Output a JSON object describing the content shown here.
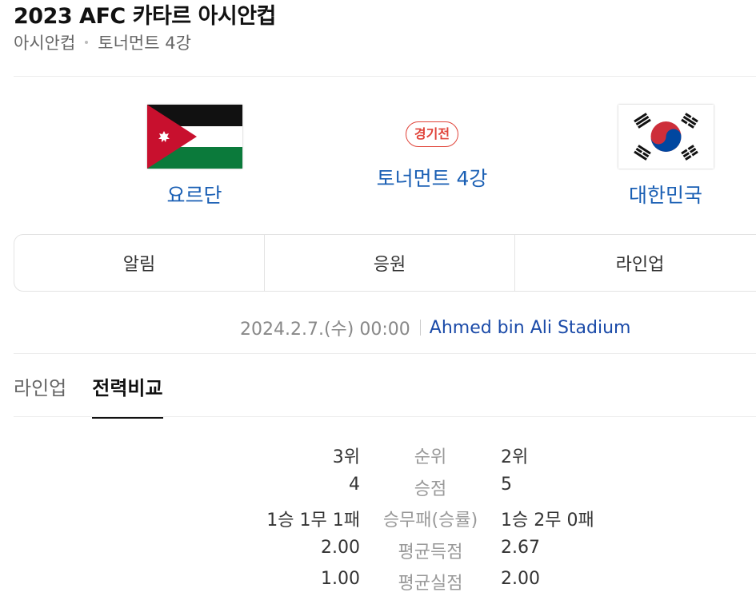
{
  "header": {
    "title": "2023 AFC 카타르 아시안컵",
    "breadcrumb": [
      "아시안컵",
      "토너먼트 4강"
    ]
  },
  "match": {
    "home_team": "요르단",
    "away_team": "대한민국",
    "status": "경기전",
    "round": "토너먼트 4강",
    "datetime": "2024.2.7.(수) 00:00",
    "venue": "Ahmed bin Ali Stadium"
  },
  "actions": [
    "알림",
    "응원",
    "라인업"
  ],
  "tabs": [
    {
      "label": "라인업",
      "active": false
    },
    {
      "label": "전력비교",
      "active": true
    }
  ],
  "stats": [
    {
      "home": "3위",
      "label": "순위",
      "away": "2위"
    },
    {
      "home": "4",
      "label": "승점",
      "away": "5"
    },
    {
      "home": "1승 1무 1패",
      "label": "승무패(승률)",
      "away": "1승 2무 0패"
    },
    {
      "home": "2.00",
      "label": "평균득점",
      "away": "2.67"
    },
    {
      "home": "1.00",
      "label": "평균실점",
      "away": "2.00"
    }
  ],
  "colors": {
    "link": "#1a5fb4",
    "venue": "#1a4aa8",
    "status": "#e0443a"
  },
  "icons": {
    "home_flag": "jordan-flag-icon",
    "away_flag": "south-korea-flag-icon"
  }
}
